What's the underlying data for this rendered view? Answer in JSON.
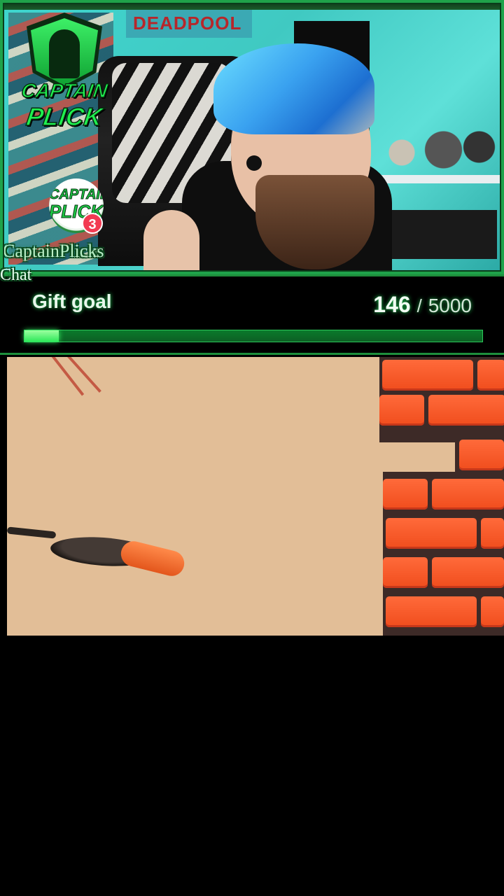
{
  "stream": {
    "logo_line1": "CAPTAIN",
    "logo_line2": "PLICK",
    "avatar_line1": "CAPTAIN",
    "avatar_line2": "PLICK",
    "notification_count": "3",
    "channel_name": "CaptainPlicks",
    "chat_label": "Chat",
    "poster_text": "DEADPOOL"
  },
  "gift_goal": {
    "title": "Gift goal",
    "current": "146",
    "separator": "/",
    "target": "5000",
    "progress_fraction": 0.0292
  },
  "colors": {
    "accent_green": "#1ff04f",
    "frame_green": "#1e8f3c",
    "badge_red": "#f23a52",
    "game_background": "#e2be97",
    "brick": "#f04d1d"
  }
}
